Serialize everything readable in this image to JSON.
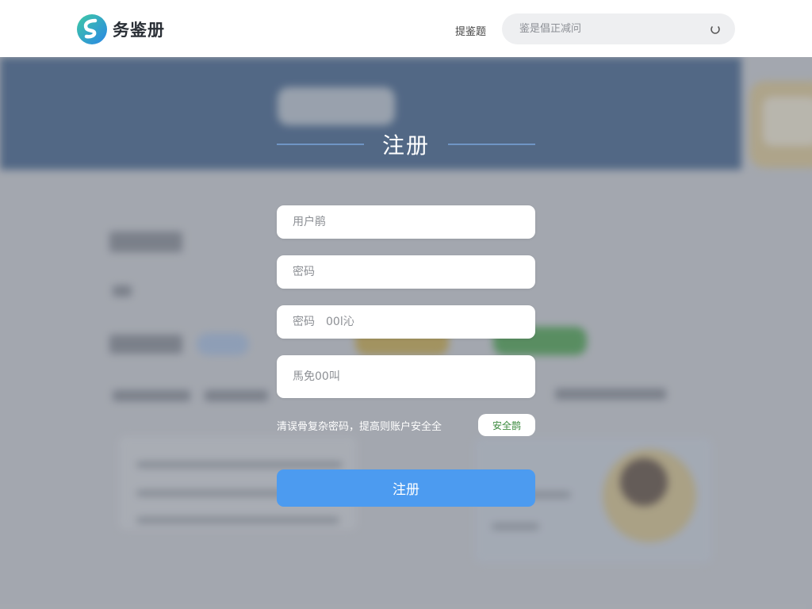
{
  "header": {
    "logo_text": "务鉴册",
    "link_label": "提鉴题",
    "search_placeholder": "鉴是倡正减问"
  },
  "form": {
    "title": "注册",
    "username_placeholder": "用户鹃",
    "password_placeholder": "密码",
    "confirm_placeholder": "密码　00l沁",
    "email_placeholder": "馬免00叫",
    "hint": "清误骨复杂密码，提高则账户安全全",
    "strength_label": "安全鹊",
    "submit_label": "注册"
  },
  "colors": {
    "accent": "#4c9bf0",
    "banner": "#4e6c92",
    "strength": "#3b8a3e"
  }
}
